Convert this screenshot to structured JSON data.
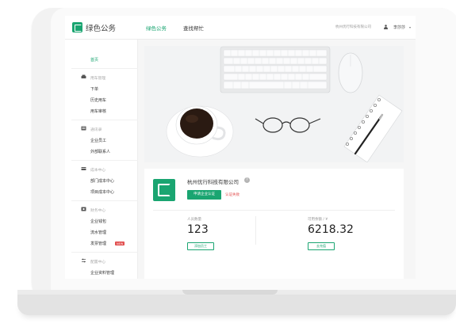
{
  "app": {
    "title": "绿色公务",
    "nav_tabs": [
      {
        "label": "绿色公务"
      },
      {
        "label": "查找帮忙"
      }
    ],
    "company_name_top": "杭州优行科技有限公司",
    "user_name": "李莎莎",
    "caret": "▾"
  },
  "sidebar": {
    "home": "首页",
    "groups": [
      {
        "title": "用车管理",
        "items": [
          "下单",
          "历史用车",
          "用车审核"
        ]
      },
      {
        "title": "通讯录",
        "items": [
          "企业员工",
          "外部联系人"
        ]
      },
      {
        "title": "成本中心",
        "items": [
          "部门成本中心",
          "项目成本中心"
        ]
      },
      {
        "title": "财务中心",
        "items": [
          "企业钱包",
          "流水管理",
          "发票管理"
        ]
      },
      {
        "title": "配置中心",
        "items": [
          "企业资料管理"
        ]
      }
    ],
    "new_badge": "NEW"
  },
  "company": {
    "name": "杭州优行科技有限公司",
    "info_icon": "?",
    "apply_button": "申请企业认证",
    "cert_status": "认证失败",
    "staff_label": "人员数量",
    "staff_count": "123",
    "add_staff_button": "添加员工",
    "balance_label": "可用余额 / ¥",
    "balance": "6218.32",
    "recharge_button": "去充值"
  },
  "colors": {
    "brand": "#1aa571",
    "danger": "#e14c4c"
  }
}
